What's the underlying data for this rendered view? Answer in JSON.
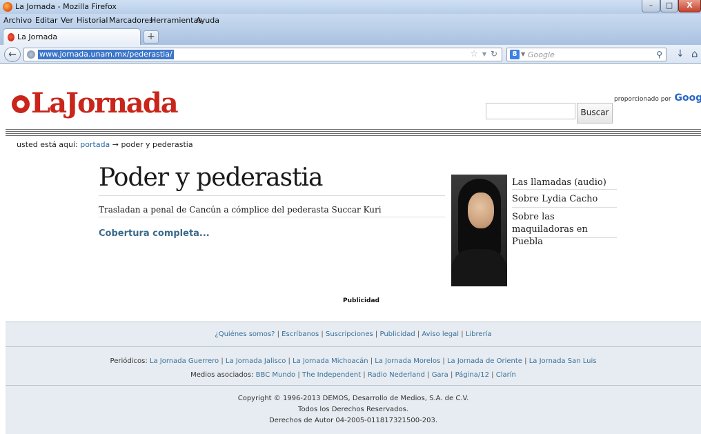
{
  "window": {
    "title": "La Jornada - Mozilla Firefox",
    "controls": {
      "minimize": "–",
      "maximize": "□",
      "close": "X"
    }
  },
  "menubar": {
    "items": [
      "Archivo",
      "Editar",
      "Ver",
      "Historial",
      "Marcadores",
      "Herramientas",
      "Ayuda"
    ]
  },
  "tabs": [
    {
      "label": "La Jornada"
    }
  ],
  "newtab_label": "+",
  "navbar": {
    "url": "www.jornada.unam.mx/pederastia/",
    "search_placeholder": "Google",
    "search_engine_letter": "8"
  },
  "header": {
    "logo_text": "LaJornada",
    "cse_label": "proporcionado por",
    "cse_brand": "Google",
    "search_button": "Buscar"
  },
  "breadcrumb": {
    "prefix": "usted está aquí:",
    "link": "portada",
    "arrow": "→",
    "current": "poder y pederastia"
  },
  "main": {
    "title": "Poder y pederastia",
    "headline": "Trasladan a penal de Cancún a cómplice del pederasta Succar Kuri",
    "cobertura": "Cobertura completa..."
  },
  "side_links": [
    "Las llamadas (audio)",
    "Sobre Lydia Cacho",
    "Sobre las maquiladoras en Puebla"
  ],
  "publicidad": "Publicidad",
  "footer": {
    "links": [
      "¿Quiénes somos?",
      "Escríbanos",
      "Suscripciones",
      "Publicidad",
      "Aviso legal",
      "Librería"
    ],
    "periodicos_label": "Periódicos:",
    "periodicos": [
      "La Jornada Guerrero",
      "La Jornada Jalisco",
      "La Jornada Michoacán",
      "La Jornada Morelos",
      "La Jornada de Oriente",
      "La Jornada San Luis"
    ],
    "medios_label": "Medios asociados:",
    "medios": [
      "BBC Mundo",
      "The Independent",
      "Radio Nederland",
      "Gara",
      "Página/12",
      "Clarín"
    ],
    "copyright": "Copyright © 1996-2013 DEMOS, Desarrollo de Medios, S.A. de C.V.",
    "rights": "Todos los Derechos Reservados.",
    "derechos": "Derechos de Autor 04-2005-011817321500-203."
  }
}
